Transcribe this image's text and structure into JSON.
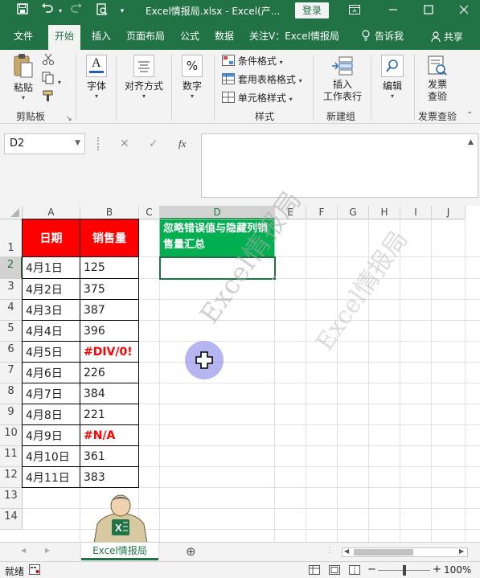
{
  "titlebar": {
    "title": "Excel情报局.xlsx  -  Excel(产...",
    "login_label": "登录",
    "colors": {
      "bg": "#217346"
    }
  },
  "menu": {
    "tabs": [
      {
        "label": "文件"
      },
      {
        "label": "开始"
      },
      {
        "label": "插入"
      },
      {
        "label": "页面布局"
      },
      {
        "label": "公式"
      },
      {
        "label": "数据"
      },
      {
        "label": "关注V：Excel情报局"
      }
    ],
    "tell_me": "告诉我",
    "share": "共享"
  },
  "ribbon": {
    "clipboard": {
      "paste_label": "粘贴",
      "group_label": "剪贴板"
    },
    "font": {
      "label": "字体"
    },
    "alignment": {
      "label": "对齐方式"
    },
    "number": {
      "label": "数字",
      "icon_glyph": "%"
    },
    "styles": {
      "conditional_format": "条件格式",
      "table_format": "套用表格格式",
      "cell_styles": "单元格样式",
      "group_label": "样式"
    },
    "cells": {
      "insert_line1": "插入",
      "insert_line2": "工作表行",
      "group_label": "新建组"
    },
    "editing": {
      "label": "编辑"
    },
    "invoice": {
      "line1": "发票",
      "line2": "查验",
      "group_label": "发票查验"
    }
  },
  "formula_bar": {
    "namebox": "D2",
    "cancel_glyph": "✕",
    "enter_glyph": "✓",
    "fx_glyph": "fx",
    "value": ""
  },
  "grid": {
    "columns": [
      "A",
      "B",
      "C",
      "D",
      "E",
      "F",
      "G",
      "H",
      "I",
      "J"
    ],
    "rows": [
      "1",
      "2",
      "3",
      "4",
      "5",
      "6",
      "7",
      "8",
      "9",
      "10",
      "11",
      "12",
      "13",
      "14"
    ],
    "header": {
      "date": "日期",
      "sales": "销售量"
    },
    "d1_text": "忽略错误值与隐藏列销售量汇总",
    "data": [
      {
        "date": "4月1日",
        "sales": "125"
      },
      {
        "date": "4月2日",
        "sales": "375"
      },
      {
        "date": "4月3日",
        "sales": "387"
      },
      {
        "date": "4月4日",
        "sales": "396"
      },
      {
        "date": "4月5日",
        "sales": "#DIV/0!"
      },
      {
        "date": "4月6日",
        "sales": "226"
      },
      {
        "date": "4月7日",
        "sales": "384"
      },
      {
        "date": "4月8日",
        "sales": "221"
      },
      {
        "date": "4月9日",
        "sales": "#N/A"
      },
      {
        "date": "4月10日",
        "sales": "361"
      },
      {
        "date": "4月11日",
        "sales": "383"
      }
    ],
    "watermark": "Excel情报局"
  },
  "sheets": {
    "active": "Excel情报局",
    "add_glyph": "⊕"
  },
  "statusbar": {
    "mode": "就绪",
    "zoom": "100%",
    "minus": "−",
    "plus": "+"
  }
}
